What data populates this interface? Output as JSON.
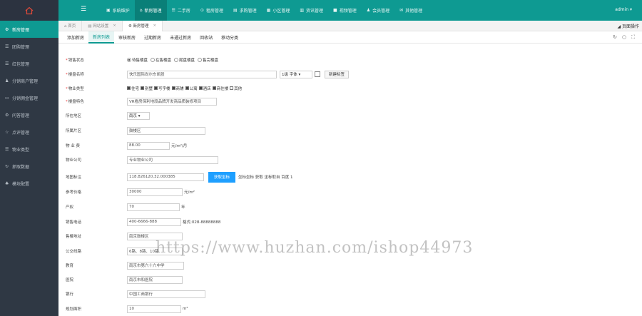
{
  "topnav": {
    "items": [
      {
        "icon": "desktop-icon",
        "glyph": "▣",
        "label": "系统维护",
        "active": false
      },
      {
        "icon": "home-icon",
        "glyph": "⌂",
        "label": "新房管理",
        "active": true
      },
      {
        "icon": "list-icon",
        "glyph": "☰",
        "label": "二手房",
        "active": false
      },
      {
        "icon": "car-icon",
        "glyph": "⊙",
        "label": "租房管理",
        "active": false
      },
      {
        "icon": "building-icon",
        "glyph": "▤",
        "label": "求购管理",
        "active": false
      },
      {
        "icon": "grid-icon",
        "glyph": "▦",
        "label": "小区管理",
        "active": false
      },
      {
        "icon": "doc-icon",
        "glyph": "▥",
        "label": "资讯管理",
        "active": false
      },
      {
        "icon": "video-icon",
        "glyph": "■",
        "label": "视频管理",
        "active": false
      },
      {
        "icon": "user-icon",
        "glyph": "♟",
        "label": "会员管理",
        "active": false
      },
      {
        "icon": "gift-icon",
        "glyph": "✉",
        "label": "其他管理",
        "active": false
      }
    ],
    "user": "admin ▾"
  },
  "sidebar": {
    "items": [
      {
        "icon": "gear-icon",
        "glyph": "⚙",
        "label": "新房管理",
        "active": true
      },
      {
        "icon": "list-icon",
        "glyph": "☰",
        "label": "团购管理",
        "active": false
      },
      {
        "icon": "list-icon",
        "glyph": "☰",
        "label": "红包管理",
        "active": false
      },
      {
        "icon": "user-icon",
        "glyph": "♟",
        "label": "分销商户管理",
        "active": false
      },
      {
        "icon": "wallet-icon",
        "glyph": "▭",
        "label": "分销佣金管理",
        "active": false
      },
      {
        "icon": "gear-icon",
        "glyph": "⚙",
        "label": "问答管理",
        "active": false
      },
      {
        "icon": "star-icon",
        "glyph": "☆",
        "label": "点评管理",
        "active": false
      },
      {
        "icon": "list-icon",
        "glyph": "☰",
        "label": "物业类型",
        "active": false
      },
      {
        "icon": "refresh-icon",
        "glyph": "↻",
        "label": "抓取数据",
        "active": false
      },
      {
        "icon": "people-icon",
        "glyph": "♣",
        "label": "模块配置",
        "active": false
      }
    ]
  },
  "tabs": {
    "items": [
      {
        "label": "⌂ 首页",
        "closable": false,
        "active": false
      },
      {
        "label": "▤ 网站设置",
        "closable": true,
        "active": false
      },
      {
        "label": "⚙ 新房管理",
        "closable": true,
        "active": true
      }
    ],
    "close_glyph": "×",
    "page_ops": "◢ 页面操作"
  },
  "subtabs": {
    "items": [
      "添加新房",
      "新房列表",
      "审核新房",
      "过期新房",
      "未通过新房",
      "回收站",
      "移动分类"
    ],
    "active_index": 1,
    "tools": [
      "↻",
      "○",
      "⛶"
    ]
  },
  "form": {
    "sale_status": {
      "label": "销售状态",
      "options": [
        "待售楼盘",
        "在售楼盘",
        "尾盘楼盘",
        "售完楼盘"
      ],
      "selected": 0
    },
    "name": {
      "label": "楼盘名称",
      "value": "快乐国际尚尔东凯股",
      "font_select": "1级 字体 ▾",
      "style_btn": "新建标签"
    },
    "property_type": {
      "label": "物业类型",
      "options": [
        "住宅",
        "别墅",
        "写字楼",
        "商铺",
        "公寓",
        "酒店",
        "商住楼",
        "其他"
      ],
      "checked": [
        0,
        1,
        2,
        3,
        4,
        5,
        6
      ]
    },
    "feature": {
      "label": "楼盘特色",
      "value": "VR看房保利地段品牌开发商品质装修项目"
    },
    "region": {
      "label": "所在地区",
      "value": "南京 ▾"
    },
    "area": {
      "label": "所属片区",
      "value": "鼓楼区"
    },
    "price": {
      "label": "物 业 费",
      "value": "88.00",
      "unit": "元/m²/月"
    },
    "company": {
      "label": "物业公司",
      "value": "专业物业公司"
    },
    "map": {
      "label": "地图标注",
      "value": "118.826120,32.000385",
      "button": "获取坐标",
      "hint": "坐标坐标 获取 坐标取自 百度 1"
    },
    "avg_price": {
      "label": "参考价格",
      "value": "30000",
      "unit": "元/m²"
    },
    "years": {
      "label": "产权",
      "value": "70",
      "unit": "年"
    },
    "phone": {
      "label": "销售电话",
      "value": "400-6666-888",
      "hint": "格式:028-88888888"
    },
    "address": {
      "label": "售楼地址",
      "value": "南京鼓楼区"
    },
    "bus": {
      "label": "公交线路",
      "value": "6路、8路、10路"
    },
    "school": {
      "label": "教育",
      "value": "南京市第六十六中学"
    },
    "hospital": {
      "label": "医院",
      "value": "南京市和医院"
    },
    "bank": {
      "label": "银行",
      "value": "中国工商银行"
    },
    "plan_area": {
      "label": "规划面积",
      "value": "10",
      "unit": "m²"
    }
  },
  "watermark": "https://www.huzhan.com/ishop44973"
}
